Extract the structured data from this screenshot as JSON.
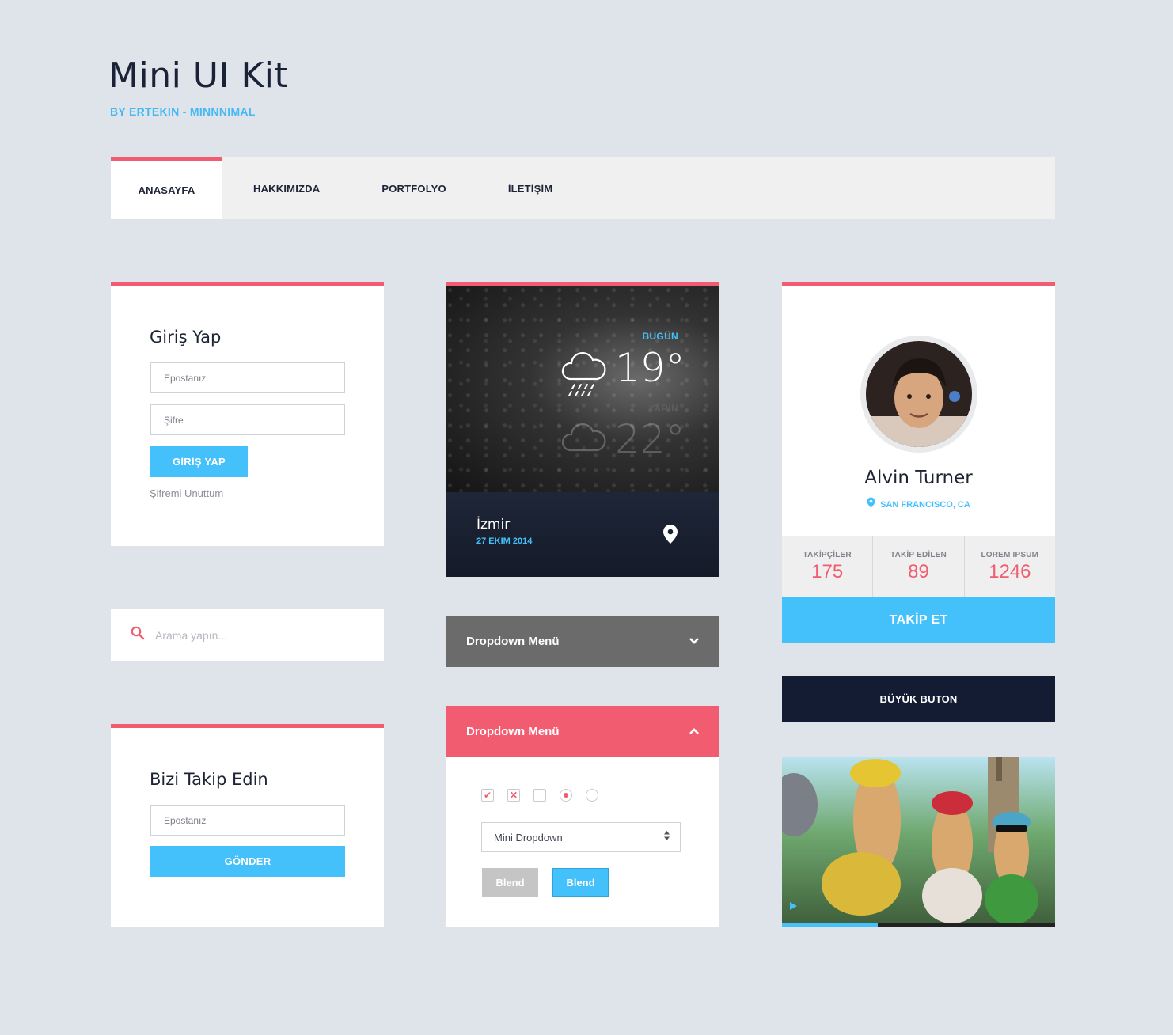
{
  "header": {
    "title": "Mini UI Kit",
    "subtitle": "BY ERTEKIN - MINNNIMAL"
  },
  "nav": {
    "tabs": [
      {
        "label": "ANASAYFA",
        "active": true
      },
      {
        "label": "HAKKIMIZDA"
      },
      {
        "label": "PORTFOLYO"
      },
      {
        "label": "İLETİŞİM"
      }
    ]
  },
  "login": {
    "title": "Giriş Yap",
    "email_placeholder": "Epostanız",
    "password_placeholder": "Şifre",
    "submit_label": "GİRİŞ YAP",
    "forgot_label": "Şifremi Unuttum"
  },
  "weather": {
    "today_label": "BUGÜN",
    "today_temp": "19°",
    "tomorrow_label": "YARIN",
    "tomorrow_temp": "22°",
    "city": "İzmir",
    "date": "27 EKIM 2014",
    "icons": [
      "rain-cloud-icon",
      "location-pin-icon"
    ]
  },
  "profile": {
    "name": "Alvin Turner",
    "location": "SAN FRANCISCO, CA",
    "stats": [
      {
        "label": "TAKİPÇİLER",
        "value": "175"
      },
      {
        "label": "TAKİP EDİLEN",
        "value": "89"
      },
      {
        "label": "LOREM IPSUM",
        "value": "1246"
      }
    ],
    "follow_label": "TAKİP ET"
  },
  "search": {
    "placeholder": "Arama yapın..."
  },
  "dropdown_gray": {
    "label": "Dropdown Menü"
  },
  "dropdown_pink": {
    "label": "Dropdown Menü",
    "mini_dropdown": "Mini Dropdown",
    "blend_gray": "Blend",
    "blend_blue": "Blend"
  },
  "follow": {
    "title": "Bizi Takip Edin",
    "email_placeholder": "Epostanız",
    "submit_label": "GÖNDER"
  },
  "big_button": {
    "label": "BÜYÜK BUTON"
  },
  "video": {
    "progress": 0.35
  },
  "colors": {
    "accent_pink": "#f25c70",
    "accent_blue": "#44c0fb",
    "navy": "#131c33",
    "bg": "#dfe3ea"
  }
}
